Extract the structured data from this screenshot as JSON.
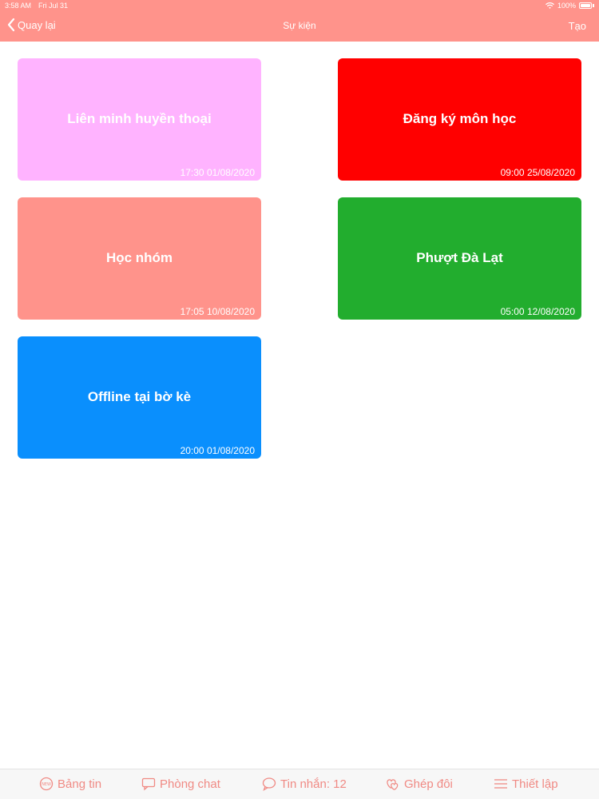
{
  "status": {
    "time": "3:58 AM",
    "date": "Fri Jul 31",
    "battery": "100%"
  },
  "nav": {
    "back_label": "Quay lại",
    "title": "Sự kiện",
    "create_label": "Tạo"
  },
  "events": [
    {
      "title": "Liên minh huyền thoại",
      "time": "17:30 01/08/2020",
      "color": "#ffb3ff"
    },
    {
      "title": "Đăng ký môn học",
      "time": "09:00 25/08/2020",
      "color": "#ff0000"
    },
    {
      "title": "Học nhóm",
      "time": "17:05 10/08/2020",
      "color": "#ff938b"
    },
    {
      "title": "Phượt Đà Lạt",
      "time": "05:00 12/08/2020",
      "color": "#22ad2e"
    },
    {
      "title": "Offline tại bờ kè",
      "time": "20:00 01/08/2020",
      "color": "#0a8ffd"
    }
  ],
  "tabs": [
    {
      "label": "Bảng tin",
      "icon": "newsfeed-icon"
    },
    {
      "label": "Phòng chat",
      "icon": "chat-room-icon"
    },
    {
      "label": "Tin nhắn: 12",
      "icon": "message-icon"
    },
    {
      "label": "Ghép đôi",
      "icon": "match-icon"
    },
    {
      "label": "Thiết lập",
      "icon": "menu-icon"
    }
  ],
  "colors": {
    "header": "#ff938b",
    "tab_text": "#f08a84"
  }
}
